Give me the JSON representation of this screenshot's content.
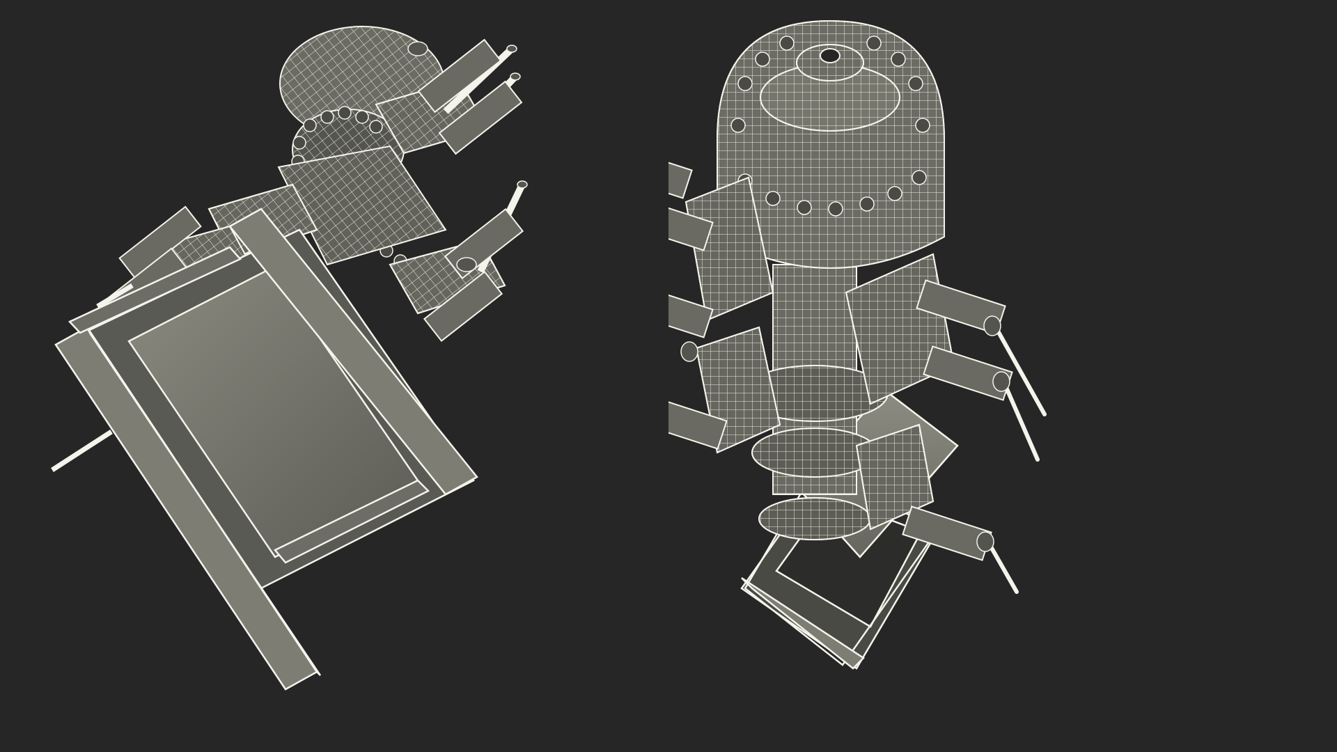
{
  "scene": {
    "background_color": "#262626",
    "model_fill_color": "#6f6f66",
    "wire_color": "#f4f4ec",
    "dark_fill_color": "#4b4b45"
  },
  "views": [
    {
      "id": "top-tilted-view",
      "subject": "wireframe-blowout-preventer-model"
    },
    {
      "id": "perspective-view",
      "subject": "wireframe-blowout-preventer-model"
    }
  ]
}
